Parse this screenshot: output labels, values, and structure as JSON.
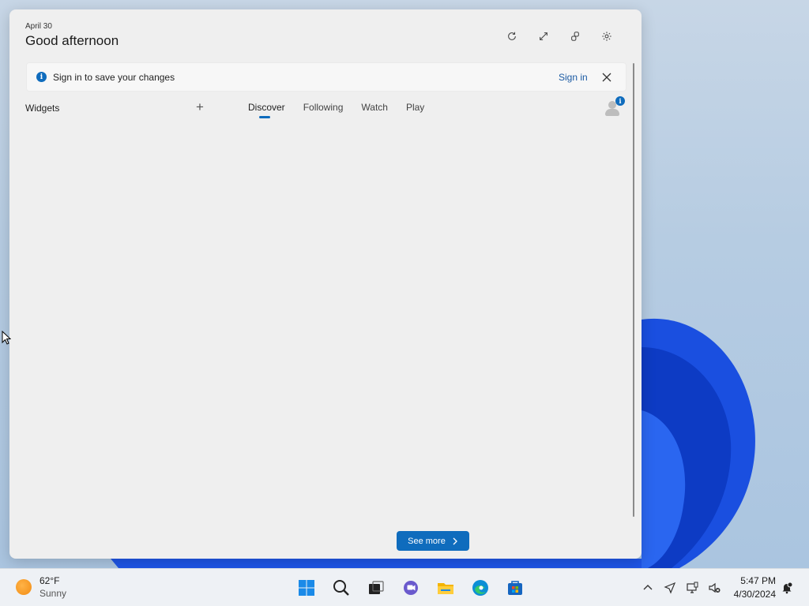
{
  "panel": {
    "date": "April 30",
    "greeting": "Good afternoon",
    "signin_banner": {
      "text": "Sign in to save your changes",
      "link": "Sign in"
    },
    "widgets_label": "Widgets",
    "add_label": "+",
    "tabs": [
      {
        "label": "Discover",
        "active": true
      },
      {
        "label": "Following",
        "active": false
      },
      {
        "label": "Watch",
        "active": false
      },
      {
        "label": "Play",
        "active": false
      }
    ],
    "profile_badge": "i",
    "see_more": "See more",
    "header_actions": [
      "refresh-icon",
      "expand-icon",
      "share-icon",
      "gear-icon"
    ]
  },
  "taskbar": {
    "weather": {
      "temp": "62°F",
      "condition": "Sunny"
    },
    "apps": [
      "windows-start-icon",
      "search-icon",
      "task-view-icon",
      "teams-chat-icon",
      "file-explorer-icon",
      "edge-icon",
      "store-icon"
    ],
    "tray": [
      "chevron-up-icon",
      "location-icon",
      "network-icon",
      "volume-muted-icon"
    ],
    "time": "5:47 PM",
    "date": "4/30/2024"
  },
  "colors": {
    "accent": "#0f6cbd",
    "panel_bg": "#efefef",
    "wallpaper_blue": "#1346d8"
  }
}
